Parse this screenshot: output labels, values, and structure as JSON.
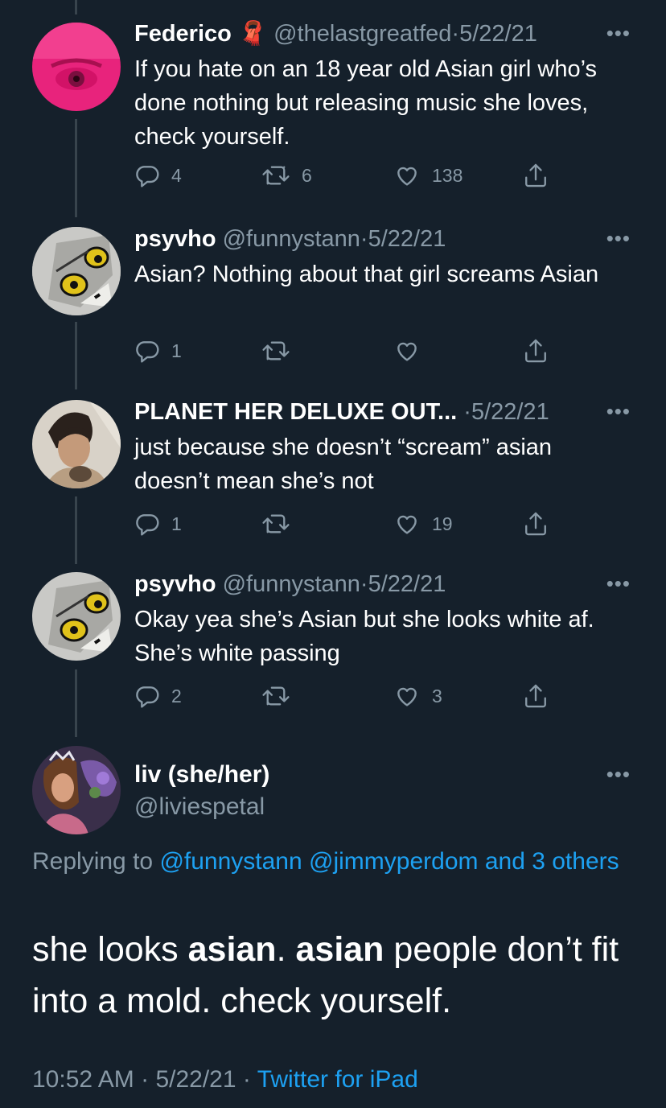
{
  "tweets": [
    {
      "name": "Federico",
      "emoji": "🧣",
      "handle": "@thelastgreatfed",
      "sep": "·",
      "date": "5/22/21",
      "text": "If you hate on an 18 year old Asian girl who’s done nothing but releasing music she loves, check yourself.",
      "replies": "4",
      "retweets": "6",
      "likes": "138"
    },
    {
      "name": "psyvho",
      "handle": "@funnystann",
      "sep": "·",
      "date": "5/22/21",
      "text": "Asian? Nothing about that girl screams Asian",
      "replies": "1",
      "retweets": "",
      "likes": ""
    },
    {
      "name": "PLANET HER DELUXE OUT...",
      "handle": "",
      "sep": "·",
      "date": "5/22/21",
      "text": "just because she doesn’t “scream” asian doesn’t mean she’s not",
      "replies": "1",
      "retweets": "",
      "likes": "19"
    },
    {
      "name": "psyvho",
      "handle": "@funnystann",
      "sep": "·",
      "date": "5/22/21",
      "text": "Okay yea she’s Asian but she looks white af. She’s white passing",
      "replies": "2",
      "retweets": "",
      "likes": "3"
    }
  ],
  "main": {
    "name": "liv (she/her)",
    "handle": "@liviespetal",
    "replying_prefix": "Replying to ",
    "replying_user1": "@funnystann",
    "replying_user2": "@jimmyperdom",
    "replying_and": "and 3 others",
    "text_1": "she looks ",
    "text_bold1": "asian",
    "text_2": ". ",
    "text_bold2": "asian",
    "text_3": " people don’t fit into a mold. check yourself.",
    "time": "10:52 AM",
    "sep": "·",
    "date": "5/22/21",
    "source": "Twitter for iPad"
  },
  "more_label": "•••",
  "icons": [
    "reply-icon",
    "retweet-icon",
    "like-icon",
    "share-icon",
    "more-icon"
  ],
  "colors": {
    "background": "#15202b",
    "secondary_text": "#8899a6",
    "link": "#1da1f2",
    "thread_line": "#38444d"
  }
}
